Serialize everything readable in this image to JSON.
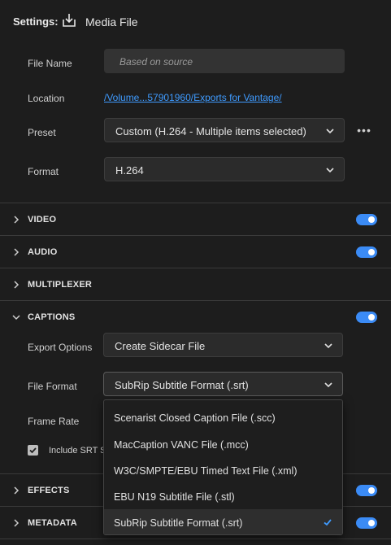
{
  "header": {
    "label": "Settings:",
    "icon": "export-download-icon",
    "title": "Media File"
  },
  "fields": {
    "file_name": {
      "label": "File Name",
      "placeholder": "Based on source"
    },
    "location": {
      "label": "Location",
      "value": "/Volume...57901960/Exports for Vantage/"
    },
    "preset": {
      "label": "Preset",
      "value": "Custom (H.264 - Multiple items selected)",
      "more_icon": "more-options-icon",
      "more_text": "•••"
    },
    "format": {
      "label": "Format",
      "value": "H.264"
    }
  },
  "sections": {
    "video": {
      "title": "VIDEO",
      "enabled": true
    },
    "audio": {
      "title": "AUDIO",
      "enabled": true
    },
    "multiplexer": {
      "title": "MULTIPLEXER"
    },
    "captions": {
      "title": "CAPTIONS",
      "enabled": true
    },
    "effects": {
      "title": "EFFECTS",
      "enabled": true
    },
    "metadata": {
      "title": "METADATA",
      "enabled": true
    }
  },
  "captions": {
    "export_options": {
      "label": "Export Options",
      "value": "Create Sidecar File"
    },
    "file_format": {
      "label": "File Format",
      "value": "SubRip Subtitle Format (.srt)"
    },
    "frame_rate": {
      "label": "Frame Rate"
    },
    "include_srt": {
      "label": "Include SRT St",
      "checked": true
    }
  },
  "file_format_dropdown": {
    "options": [
      "Scenarist Closed Caption File (.scc)",
      "MacCaption VANC File (.mcc)",
      "W3C/SMPTE/EBU Timed Text File (.xml)",
      "EBU N19 Subtitle File (.stl)",
      "SubRip Subtitle Format (.srt)"
    ],
    "selected_index": 4
  },
  "colors": {
    "accent": "#3b8bf5",
    "link": "#3f9bff",
    "background": "#1d1d1d"
  }
}
